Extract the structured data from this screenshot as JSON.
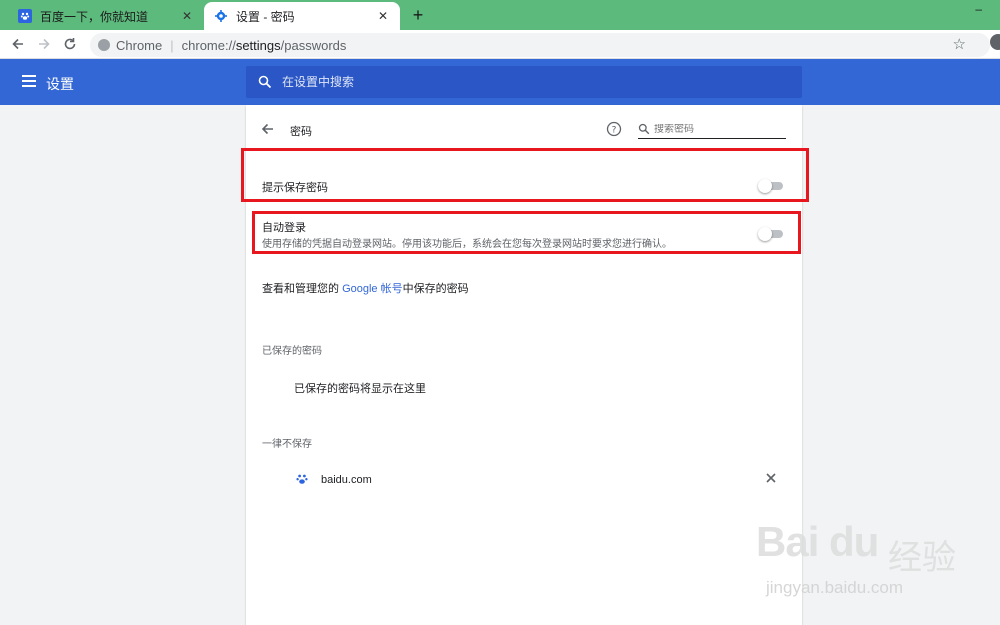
{
  "browser": {
    "tabs": [
      {
        "title": "百度一下，你就知道",
        "close": "✕",
        "favicon": "baidu-paw-icon"
      },
      {
        "title": "设置 - 密码",
        "close": "✕",
        "favicon": "settings-gear-icon"
      }
    ],
    "new_tab": "+",
    "window_min": "–",
    "omnibox": {
      "site_label": "Chrome",
      "separator": "|",
      "url_scheme": "chrome://",
      "url_path": "settings",
      "url_rest": "/passwords"
    }
  },
  "settings": {
    "title": "设置",
    "search_placeholder": "在设置中搜索"
  },
  "passwords": {
    "page_title": "密码",
    "search_placeholder": "搜索密码",
    "offer_to_save": {
      "label": "提示保存密码",
      "enabled": false
    },
    "auto_signin": {
      "label": "自动登录",
      "description": "使用存储的凭据自动登录网站。停用该功能后，系统会在您每次登录网站时要求您进行确认。",
      "enabled": false
    },
    "google_account": {
      "prefix": "查看和管理您的 ",
      "link": "Google 帐号",
      "suffix": "中保存的密码"
    },
    "saved_heading": "已保存的密码",
    "saved_empty": "已保存的密码将显示在这里",
    "never_saved_heading": "一律不保存",
    "never_saved_sites": [
      {
        "site": "baidu.com",
        "remove": "✕"
      }
    ]
  },
  "colors": {
    "header_blue": "#3367d6",
    "tab_strip_green": "#5dba7d",
    "highlight_red": "#e8171f",
    "link_blue": "#3367d6"
  },
  "watermark": {
    "logo_text": "Bai du",
    "logo_cn": "经验",
    "url": "jingyan.baidu.com"
  }
}
